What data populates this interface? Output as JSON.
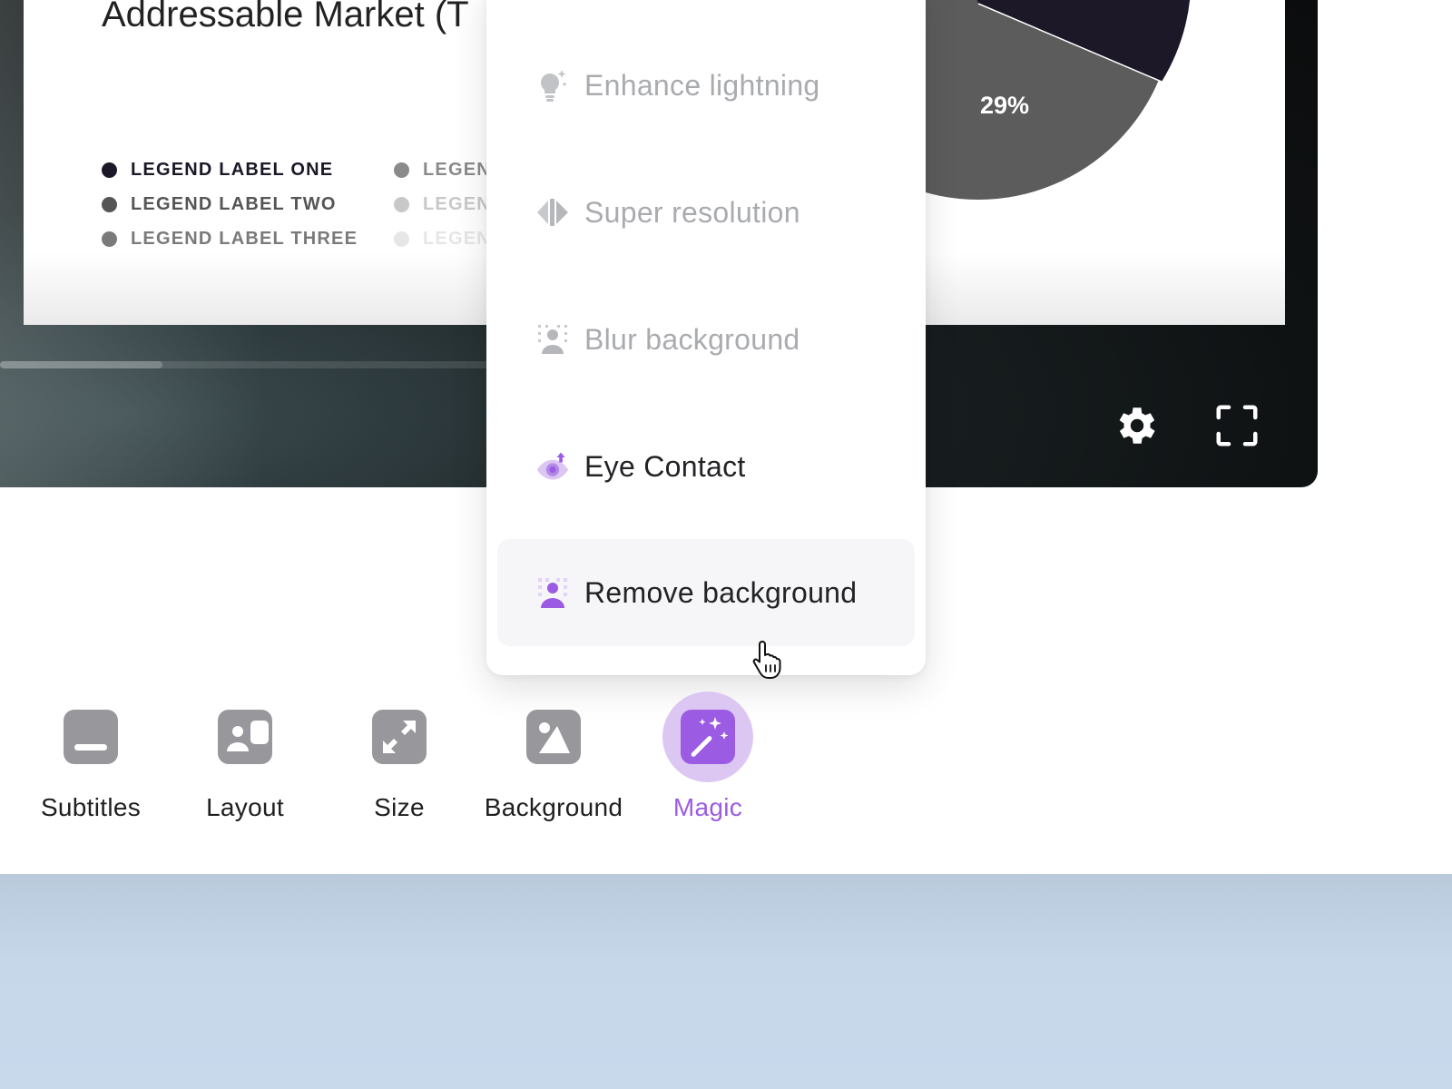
{
  "slide": {
    "title": "Addressable Market (T",
    "legend_left": [
      {
        "label": "LEGEND LABEL ONE",
        "color": "#1c1828"
      },
      {
        "label": "LEGEND LABEL TWO",
        "color": "#555555"
      },
      {
        "label": "LEGEND LABEL THREE",
        "color": "#7a7a7a"
      }
    ],
    "legend_right": [
      {
        "label": "LEGEN",
        "color": "#8a8a8a"
      },
      {
        "label": "LEGEN",
        "color": "#c8c8c8"
      },
      {
        "label": "LEGEN",
        "color": "#e6e6e6"
      }
    ],
    "pie_label": "29%"
  },
  "player": {
    "progress": 0.32,
    "settings_icon": "gear-icon",
    "fullscreen_icon": "fullscreen-icon"
  },
  "menu": {
    "items": [
      {
        "label": "Enhance lightning",
        "icon": "lightbulb-sparkle-icon",
        "enabled": false
      },
      {
        "label": "Super resolution",
        "icon": "super-resolution-icon",
        "enabled": false
      },
      {
        "label": "Blur background",
        "icon": "blur-background-icon",
        "enabled": false
      },
      {
        "label": "Eye Contact",
        "icon": "eye-contact-icon",
        "enabled": true
      },
      {
        "label": "Remove background",
        "icon": "remove-background-icon",
        "enabled": true,
        "hovered": true
      }
    ]
  },
  "toolbar": {
    "items": [
      {
        "label": "Subtitles",
        "icon": "subtitles-icon",
        "active": false
      },
      {
        "label": "Layout",
        "icon": "layout-icon",
        "active": false
      },
      {
        "label": "Size",
        "icon": "resize-icon",
        "active": false
      },
      {
        "label": "Background",
        "icon": "background-image-icon",
        "active": false
      },
      {
        "label": "Magic",
        "icon": "magic-wand-icon",
        "active": true
      }
    ]
  },
  "colors": {
    "accent": "#9b5ce3",
    "accent_soft": "#dcc7f3",
    "disabled_text": "#a9abaf",
    "bottom_band": "#c6d7ea"
  }
}
